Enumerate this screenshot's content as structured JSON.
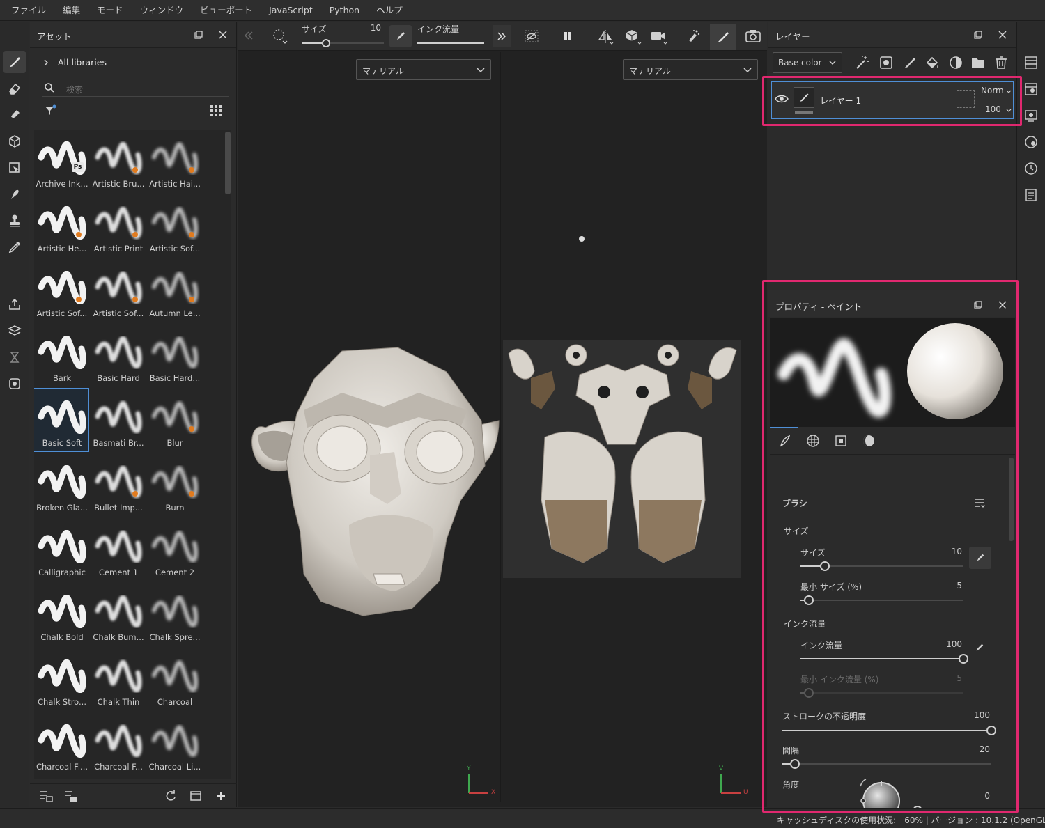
{
  "menu": [
    "ファイル",
    "編集",
    "モード",
    "ウィンドウ",
    "ビューポート",
    "JavaScript",
    "Python",
    "ヘルプ"
  ],
  "assets": {
    "title": "アセット",
    "library": "All libraries",
    "search_placeholder": "検索",
    "brushes": [
      {
        "label": "Archive Ink...",
        "ps": true
      },
      {
        "label": "Artistic Bru..."
      },
      {
        "label": "Artistic Hai..."
      },
      {
        "label": "Artistic He..."
      },
      {
        "label": "Artistic Print"
      },
      {
        "label": "Artistic Sof..."
      },
      {
        "label": "Artistic Sof..."
      },
      {
        "label": "Artistic Sof..."
      },
      {
        "label": "Autumn Le..."
      },
      {
        "label": "Bark"
      },
      {
        "label": "Basic Hard"
      },
      {
        "label": "Basic Hard..."
      },
      {
        "label": "Basic Soft",
        "selected": true
      },
      {
        "label": "Basmati Br..."
      },
      {
        "label": "Blur"
      },
      {
        "label": "Broken Gla..."
      },
      {
        "label": "Bullet Imp..."
      },
      {
        "label": "Burn"
      },
      {
        "label": "Calligraphic"
      },
      {
        "label": "Cement 1"
      },
      {
        "label": "Cement 2"
      },
      {
        "label": "Chalk Bold"
      },
      {
        "label": "Chalk Bum..."
      },
      {
        "label": "Chalk Spre..."
      },
      {
        "label": "Chalk Stro..."
      },
      {
        "label": "Chalk Thin"
      },
      {
        "label": "Charcoal"
      },
      {
        "label": "Charcoal Fi..."
      },
      {
        "label": "Charcoal F..."
      },
      {
        "label": "Charcoal Li..."
      }
    ]
  },
  "toolbar": {
    "size_label": "サイズ",
    "size_value": "10",
    "size_fraction": 0.1,
    "flow_label": "インク流量"
  },
  "viewport": {
    "left_dropdown": "マテリアル",
    "right_dropdown": "マテリアル",
    "axis_y": "Y",
    "axis_x": "X",
    "axis_v": "V",
    "axis_u": "U"
  },
  "layers": {
    "title": "レイヤー",
    "channel": "Base color",
    "layer_name": "レイヤー 1",
    "blend_mode": "Norm",
    "opacity": "100"
  },
  "properties": {
    "title": "プロパティ - ペイント",
    "section": "ブラシ",
    "size_group": "サイズ",
    "size_label": "サイズ",
    "size_value": "10",
    "size_fraction": 0.15,
    "min_size_label": "最小 サイズ (%)",
    "min_size_value": "5",
    "min_size_fraction": 0.05,
    "flow_group": "インク流量",
    "flow_label": "インク流量",
    "flow_value": "100",
    "flow_fraction": 1.0,
    "min_flow_label": "最小 インク流量 (%)",
    "min_flow_value": "5",
    "min_flow_fraction": 0.05,
    "stroke_opacity_label": "ストロークの不透明度",
    "stroke_opacity_value": "100",
    "stroke_opacity_fraction": 1.0,
    "spacing_label": "間隔",
    "spacing_value": "20",
    "spacing_fraction": 0.06,
    "angle_label": "角度",
    "angle_value": "0",
    "angle_fraction": 0.0
  },
  "status": {
    "text": "キャッシュディスクの使用状況:　60% | バージョン : 10.1.2 (OpenGL)"
  },
  "colors": {
    "highlight": "#e0286f",
    "accent": "#4f8fd6",
    "badge": "#e07b1f"
  }
}
